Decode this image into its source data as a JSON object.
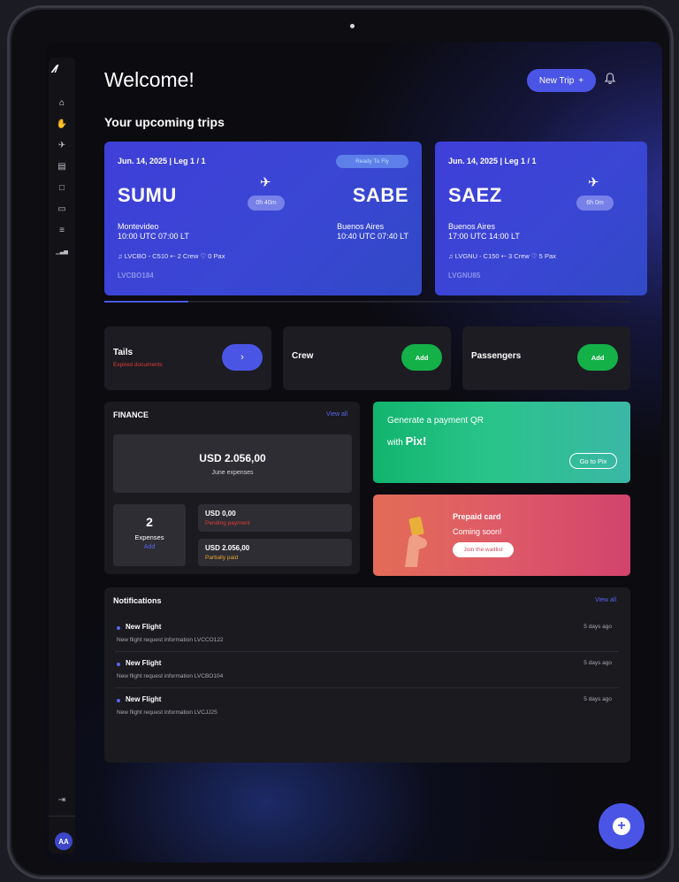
{
  "header": {
    "welcome": "Welcome!",
    "new_trip": "New Trip",
    "new_trip_icon": "+",
    "bell_icon": "bell-icon"
  },
  "sidebar": {
    "logo": "⁄⁄/",
    "items": [
      {
        "name": "home-icon",
        "glyph": "⌂"
      },
      {
        "name": "hand-icon",
        "glyph": "✋"
      },
      {
        "name": "plane-icon",
        "glyph": "✈"
      },
      {
        "name": "calendar-icon",
        "glyph": "▤"
      },
      {
        "name": "document-icon",
        "glyph": "□"
      },
      {
        "name": "card-icon",
        "glyph": "▭"
      },
      {
        "name": "file-icon",
        "glyph": "≡"
      },
      {
        "name": "chart-icon",
        "glyph": "▁▃▅"
      }
    ],
    "logout_glyph": "⇥",
    "avatar": "AA"
  },
  "trips_title": "Your upcoming trips",
  "trips": [
    {
      "date": "Jun. 14, 2025  |  Leg 1 / 1",
      "status": "Ready To Fly",
      "from_code": "SUMU",
      "to_code": "SABE",
      "duration": "0h 40m",
      "from_city": "Montevideo",
      "from_time": "10:00 UTC  07:00 LT",
      "to_city": "Buenos Aires",
      "to_time": "10:40 UTC  07:40 LT",
      "info": "♫  LVCBO - C510   ⇠  2 Crew  ♡  0 Pax",
      "reg": "LVCBO184"
    },
    {
      "date": "Jun. 14, 2025  |  Leg 1 / 1",
      "from_code": "SAEZ",
      "duration": "6h 0m",
      "from_city": "Buenos Aires",
      "from_time": "17:00 UTC  14:00 LT",
      "info": "♫  LVGNU - C150   ⇠  3 Crew  ♡  5 Pax",
      "reg": "LVGNU85"
    }
  ],
  "tiles": {
    "tails": {
      "label": "Tails",
      "warning": "Expired documents",
      "action": "›"
    },
    "crew": {
      "label": "Crew",
      "action": "Add"
    },
    "passengers": {
      "label": "Passengers",
      "action": "Add"
    }
  },
  "finance": {
    "title": "FINANCE",
    "view_all": "View all",
    "amount": "USD 2.056,00",
    "amount_sub": "June expenses",
    "expenses_count": "2",
    "expenses_label": "Expenses",
    "expenses_add": "Add",
    "rows": [
      {
        "value": "USD 0,00",
        "status": "Pending payment",
        "color": "#e13a3a"
      },
      {
        "value": "USD 2.056,00",
        "status": "Partially paid",
        "color": "#e8a637"
      }
    ]
  },
  "pix": {
    "line1": "Generate a payment QR",
    "line2_prefix": "with ",
    "line2_brand": "Pix!",
    "button": "Go to Pix"
  },
  "prepaid": {
    "title": "Prepaid card",
    "subtitle": "Coming soon!",
    "button": "Join the waitlist"
  },
  "notifications": {
    "title": "Notifications",
    "view_all": "View all",
    "items": [
      {
        "title": "New Flight",
        "desc": "New flight request information LVCCO122",
        "time": "5 days ago"
      },
      {
        "title": "New Flight",
        "desc": "New flight request information LVCBO104",
        "time": "5 days ago"
      },
      {
        "title": "New Flight",
        "desc": "New flight request information LVCJJ25",
        "time": "5 days ago"
      }
    ]
  },
  "fab_icon": "+",
  "colors": {
    "accent": "#4a55e6",
    "success": "#14b048",
    "danger": "#e13a3a",
    "warning": "#e8a637"
  }
}
